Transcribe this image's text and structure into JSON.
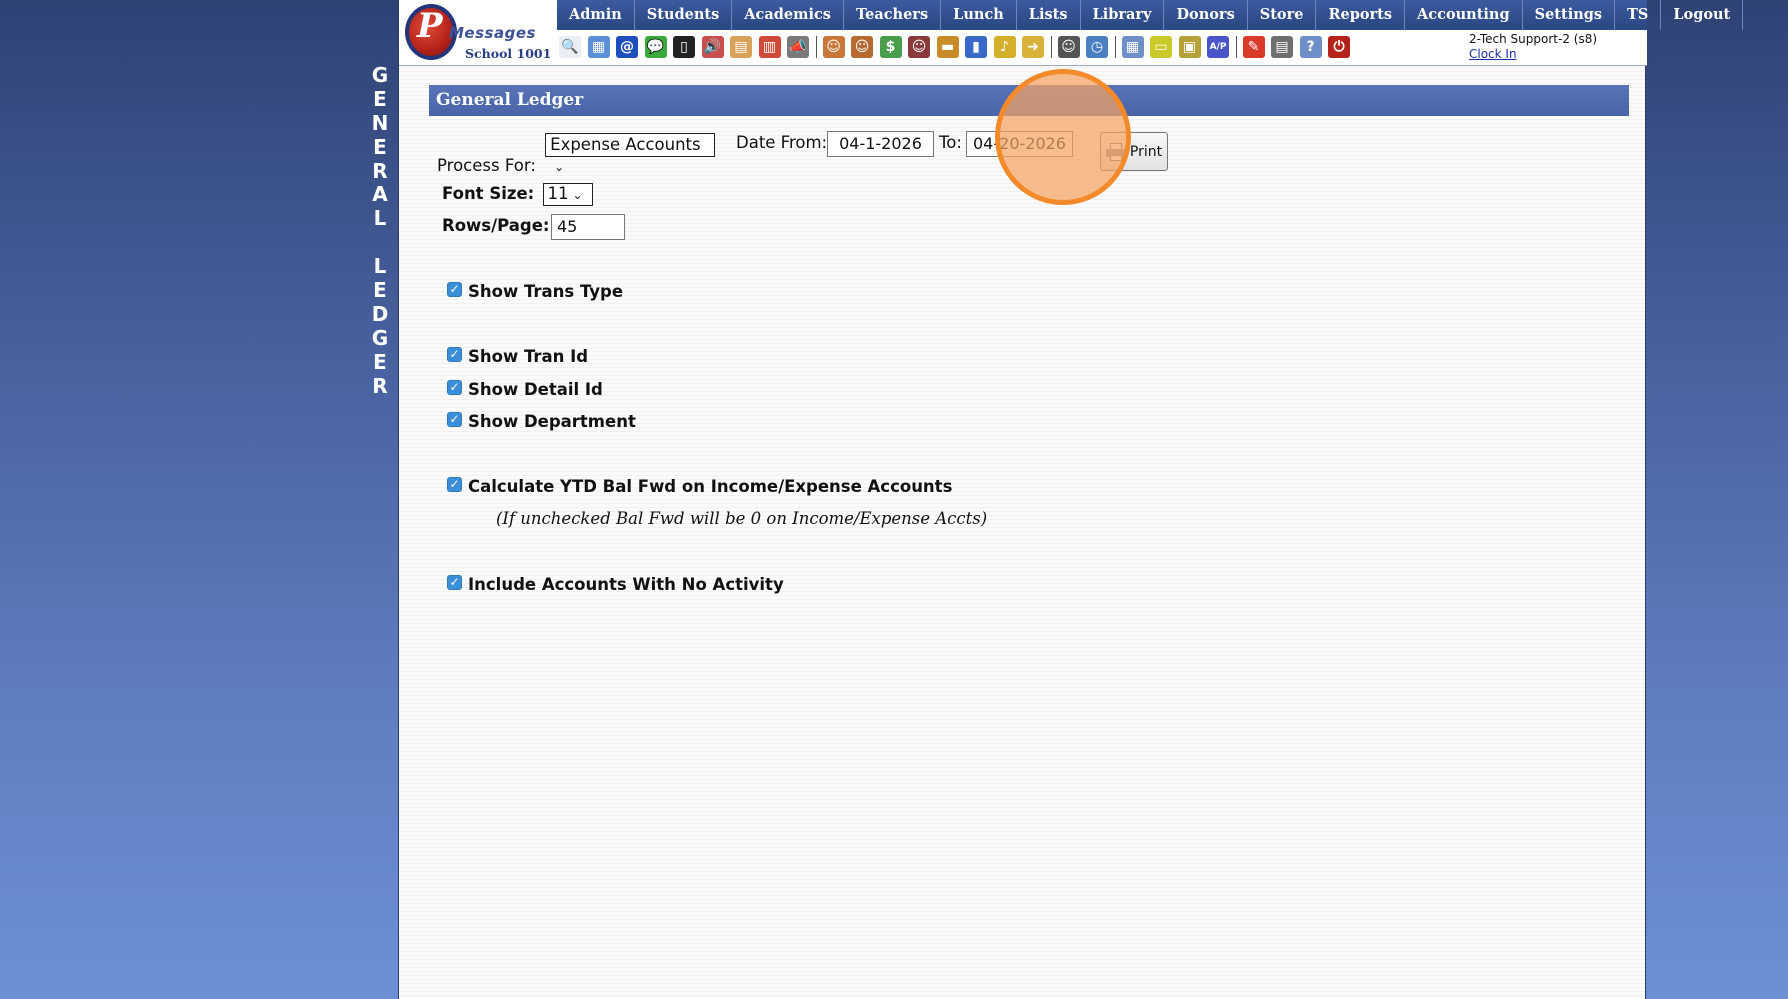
{
  "vertical_title": [
    "G",
    "E",
    "N",
    "E",
    "R",
    "A",
    "L",
    "",
    "L",
    "E",
    "D",
    "G",
    "E",
    "R"
  ],
  "logo": {
    "brand": "Messages",
    "school": "School 1001"
  },
  "nav": {
    "items": [
      {
        "label": "Admin"
      },
      {
        "label": "Students"
      },
      {
        "label": "Academics"
      },
      {
        "label": "Teachers"
      },
      {
        "label": "Lunch"
      },
      {
        "label": "Lists"
      },
      {
        "label": "Library"
      },
      {
        "label": "Donors"
      },
      {
        "label": "Store"
      },
      {
        "label": "Reports"
      },
      {
        "label": "Accounting"
      },
      {
        "label": "Settings"
      },
      {
        "label": "TS"
      },
      {
        "label": "Logout"
      }
    ]
  },
  "toolbar": {
    "icons": [
      {
        "name": "search-icon",
        "glyph": "🔍",
        "color": "#e9eef5"
      },
      {
        "name": "grid-icon",
        "glyph": "▦",
        "color": "#5b8fd8"
      },
      {
        "name": "email-at-icon",
        "glyph": "@",
        "color": "#1f4fbf"
      },
      {
        "name": "chat-icon",
        "glyph": "💬",
        "color": "#3aa83a"
      },
      {
        "name": "mobile-phone-icon",
        "glyph": "▯",
        "color": "#222222"
      },
      {
        "name": "speaker-icon",
        "glyph": "🔊",
        "color": "#c94f4f"
      },
      {
        "name": "newsletter-icon",
        "glyph": "▤",
        "color": "#d9a25a"
      },
      {
        "name": "calendar-icon",
        "glyph": "▥",
        "color": "#d04a3a"
      },
      {
        "name": "megaphone-icon",
        "glyph": "📣",
        "color": "#7a7a7a"
      },
      {
        "name": "sep",
        "glyph": "",
        "color": ""
      },
      {
        "name": "student-add-icon",
        "glyph": "☺",
        "color": "#c9783a"
      },
      {
        "name": "teacher-icon",
        "glyph": "☺",
        "color": "#b8692f"
      },
      {
        "name": "money-icon",
        "glyph": "$",
        "color": "#4a9d4a"
      },
      {
        "name": "parents-icon",
        "glyph": "☺",
        "color": "#8a3a3a"
      },
      {
        "name": "lunch-icon",
        "glyph": "▬",
        "color": "#c98a2a"
      },
      {
        "name": "book-icon",
        "glyph": "▮",
        "color": "#3a6ac9"
      },
      {
        "name": "bell-icon",
        "glyph": "♪",
        "color": "#d4b02a"
      },
      {
        "name": "folder-arrow-icon",
        "glyph": "➜",
        "color": "#d9b23a"
      },
      {
        "name": "sep",
        "glyph": "",
        "color": ""
      },
      {
        "name": "staff-icon",
        "glyph": "☺",
        "color": "#555555"
      },
      {
        "name": "clock-icon",
        "glyph": "◷",
        "color": "#4a7fc1"
      },
      {
        "name": "sep",
        "glyph": "",
        "color": ""
      },
      {
        "name": "spreadsheet-icon",
        "glyph": "▦",
        "color": "#6f8fc9"
      },
      {
        "name": "ticket-icon",
        "glyph": "▭",
        "color": "#c9c92a"
      },
      {
        "name": "cash-register-icon",
        "glyph": "▣",
        "color": "#b5a03a"
      },
      {
        "name": "accounts-payable-icon",
        "glyph": "A/P",
        "color": "#4a55c9"
      },
      {
        "name": "sep",
        "glyph": "",
        "color": ""
      },
      {
        "name": "pdf-icon",
        "glyph": "✎",
        "color": "#d93a2a"
      },
      {
        "name": "printer-stack-icon",
        "glyph": "▤",
        "color": "#6f6f6f"
      },
      {
        "name": "help-icon",
        "glyph": "?",
        "color": "#6f8fc9"
      },
      {
        "name": "power-icon",
        "glyph": "⏻",
        "color": "#b5221a"
      }
    ]
  },
  "user": {
    "name": "2-Tech Support-2 (s8)",
    "clock_in": "Clock In"
  },
  "panel": {
    "title": "General Ledger"
  },
  "form": {
    "process_for_label": "Process For:",
    "process_for_value": "Expense Accounts",
    "date_from_label": "Date From:",
    "date_from_value": "04-1-2026",
    "to_label": "To:",
    "to_value": "04-20-2026",
    "print_label": "Print",
    "font_size_label": "Font Size:",
    "font_size_value": "11",
    "rows_page_label": "Rows/Page:",
    "rows_page_value": "45"
  },
  "options": {
    "show_trans_type": "Show Trans Type",
    "show_tran_id": "Show Tran Id",
    "show_detail_id": "Show Detail Id",
    "show_department": "Show Department",
    "calc_ytd": "Calculate YTD Bal Fwd on Income/Expense Accounts",
    "calc_ytd_note": "(If unchecked Bal Fwd will be 0 on Income/Expense Accts)",
    "include_no_activity": "Include Accounts With No Activity"
  },
  "colors": {
    "nav_bg": "#284780",
    "panel_bg": "#4a64a8",
    "checkbox": "#3b8ed8",
    "highlight": "#f58a2a"
  }
}
